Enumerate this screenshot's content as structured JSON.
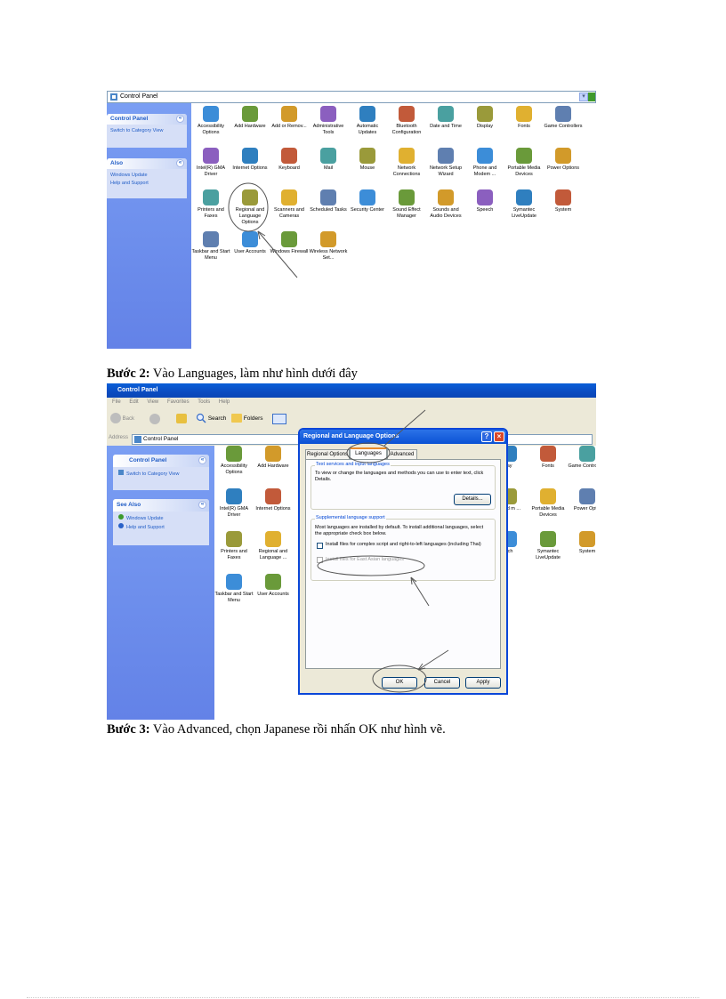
{
  "shot1": {
    "address": "Control Panel",
    "side_task": {
      "title": "Control Panel",
      "link": "Switch to Category View"
    },
    "side_also": {
      "title": "Also",
      "links": [
        "Windows Update",
        "Help and Support"
      ]
    },
    "icons": [
      [
        "Accessibility Options",
        "Add Hardware",
        "Add or Remov...",
        "Administrative Tools",
        "Automatic Updates",
        "Bluetooth Configuration",
        "Date and Time",
        "Display",
        "Fonts",
        "Game Controllers"
      ],
      [
        "Intel(R) GMA Driver",
        "Internet Options",
        "Keyboard",
        "Mail",
        "Mouse",
        "Network Connections",
        "Network Setup Wizard",
        "Phone and Modem ...",
        "Portable Media Devices",
        "Power Options"
      ],
      [
        "Printers and Faxes",
        "Regional and Language Options",
        "Scanners and Cameras",
        "Scheduled Tasks",
        "Security Center",
        "Sound Effect Manager",
        "Sounds and Audio Devices",
        "Speech",
        "Symantec LiveUpdate",
        "System"
      ],
      [
        "Taskbar and Start Menu",
        "User Accounts",
        "Windows Firewall",
        "Wireless Network Set..."
      ]
    ]
  },
  "caption2": {
    "bold": "Bước 2:",
    "text": " Vào Languages,  làm như hình  dưới đây"
  },
  "shot2": {
    "window_title": "Control Panel",
    "menu": [
      "File",
      "Edit",
      "View",
      "Favorites",
      "Tools",
      "Help"
    ],
    "toolbar": {
      "back": "Back",
      "search": "Search",
      "folders": "Folders"
    },
    "address_label": "Address",
    "address": "Control Panel",
    "side_task": {
      "title": "Control Panel",
      "link": "Switch to Category View"
    },
    "side_also": {
      "title": "See Also",
      "links": [
        "Windows Update",
        "Help and Support"
      ]
    },
    "icons_left": [
      [
        "Accessibility Options",
        "Add Hardware"
      ],
      [
        "Intel(R) GMA Driver",
        "Internet Options"
      ],
      [
        "Printers and Faxes",
        "Regional and Language ..."
      ],
      [
        "Taskbar and Start Menu",
        "User Accounts"
      ]
    ],
    "icons_right": [
      [
        "lay",
        "Fonts",
        "Game Controllers"
      ],
      [
        "e and m ...",
        "Portable Media Devices",
        "Power Optio"
      ],
      [
        "ech",
        "Symantec LiveUpdate",
        "System"
      ]
    ],
    "dialog": {
      "title": "Regional and Language Options",
      "help_btn": "?",
      "close_btn": "×",
      "tabs": [
        "Regional Options",
        "Languages",
        "Advanced"
      ],
      "group1": {
        "label": "Text services and input languages",
        "text": "To view or change the languages and methods you can use to enter text, click Details.",
        "button": "Details..."
      },
      "group2": {
        "label": "Supplemental language support",
        "text": "Most languages are installed by default. To install additional languages, select the appropriate check box below.",
        "check1": "Install files for complex script and right-to-left languages (including Thai)",
        "check2": "Install files for East Asian languages"
      },
      "buttons": {
        "ok": "OK",
        "cancel": "Cancel",
        "apply": "Apply"
      }
    }
  },
  "caption3": {
    "bold": "Bước 3:",
    "text": " Vào Advanced,  chọn Japanese rồi nhấn  OK như hình  vẽ."
  }
}
